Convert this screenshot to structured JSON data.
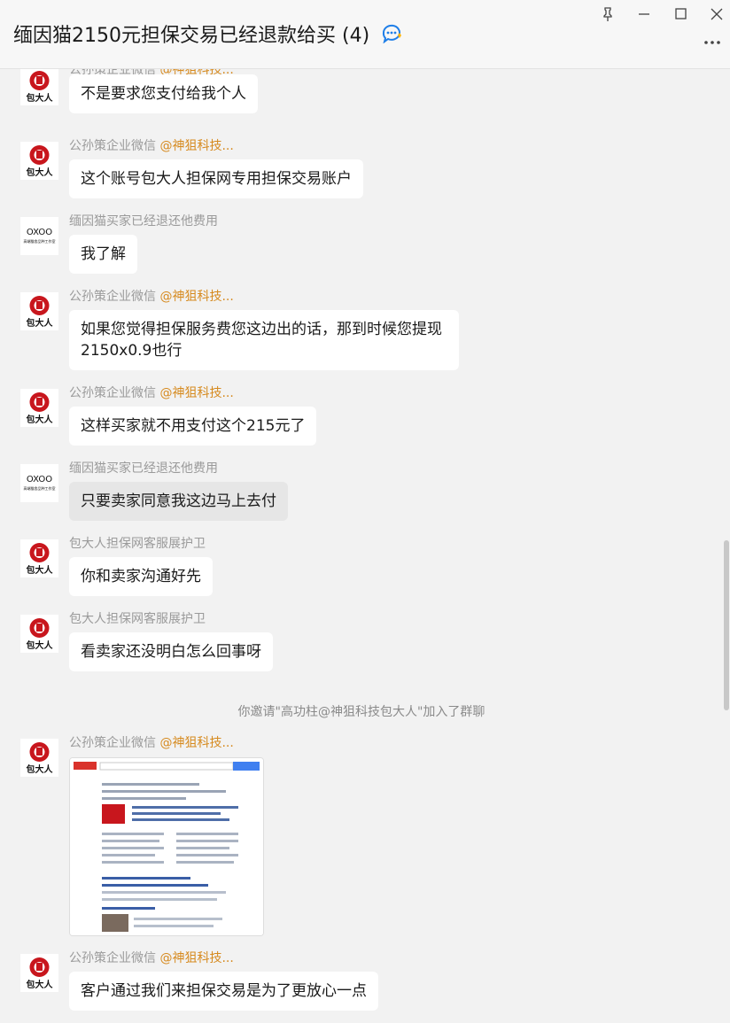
{
  "window": {
    "title": "缅因猫2150元担保交易已经退款给买",
    "member_count": "(4)",
    "buttons": [
      "pin-icon",
      "minimize-icon",
      "maximize-icon",
      "close-icon"
    ],
    "more_icon": "more-icon"
  },
  "logos": {
    "baodaren": "包大人",
    "oxoo": "OXOO",
    "oxoo_sub": "高端猫舍品种工作室"
  },
  "messages": [
    {
      "sender": "公孙策企业微信",
      "mention": "@神狙科技...",
      "text": "不是要求您支付给我个人",
      "avatar": "baodaren"
    },
    {
      "sender": "公孙策企业微信",
      "mention": "@神狙科技...",
      "text": "这个账号包大人担保网专用担保交易账户",
      "avatar": "baodaren"
    },
    {
      "sender": "缅因猫买家已经退还他费用",
      "mention": "",
      "text": "我了解",
      "avatar": "oxoo"
    },
    {
      "sender": "公孙策企业微信",
      "mention": "@神狙科技...",
      "text": "如果您觉得担保服务费您这边出的话，那到时候您提现2150x0.9也行",
      "avatar": "baodaren"
    },
    {
      "sender": "公孙策企业微信",
      "mention": "@神狙科技...",
      "text": "这样买家就不用支付这个215元了",
      "avatar": "baodaren"
    },
    {
      "sender": "缅因猫买家已经退还他费用",
      "mention": "",
      "text": "只要卖家同意我这边马上去付",
      "avatar": "oxoo"
    },
    {
      "sender": "包大人担保网客服展护卫",
      "mention": "",
      "text": "你和卖家沟通好先",
      "avatar": "baodaren"
    },
    {
      "sender": "包大人担保网客服展护卫",
      "mention": "",
      "text": "看卖家还没明白怎么回事呀",
      "avatar": "baodaren"
    },
    {
      "sender": "公孙策企业微信",
      "mention": "@神狙科技...",
      "text": "",
      "avatar": "baodaren",
      "image": "search-screenshot"
    },
    {
      "sender": "公孙策企业微信",
      "mention": "@神狙科技...",
      "text": "客户通过我们来担保交易是为了更放心一点",
      "avatar": "baodaren"
    }
  ],
  "system_notice": "你邀请\"高功柱@神狙科技包大人\"加入了群聊",
  "colors": {
    "accent_mention": "#d68a1f",
    "logo_red": "#c8161d",
    "bubble_white": "#ffffff",
    "bubble_self": "#e6e6e6",
    "background": "#f2f2f2"
  }
}
